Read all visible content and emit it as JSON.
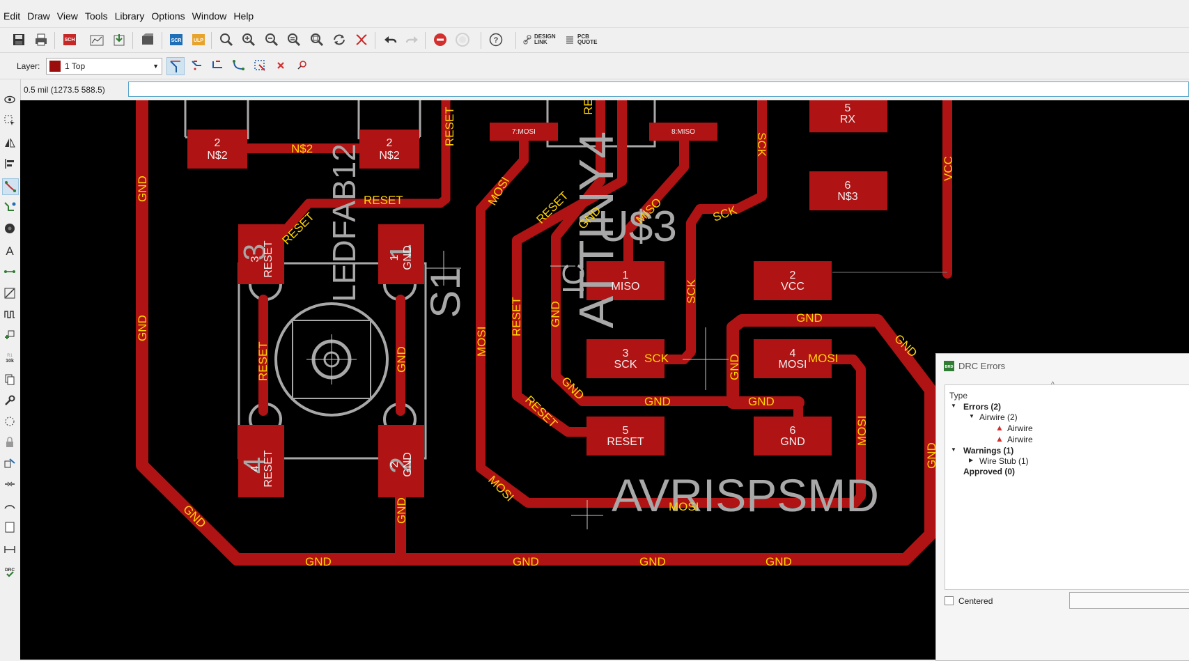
{
  "menu": [
    "Edit",
    "Draw",
    "View",
    "Tools",
    "Library",
    "Options",
    "Window",
    "Help"
  ],
  "toolbar": {
    "design_link": [
      "DESIGN",
      "LINK"
    ],
    "pcb_quote": [
      "PCB",
      "QUOTE"
    ],
    "sch_label": "SCH",
    "scr_label": "SCR",
    "ulp_label": "ULP"
  },
  "layer": {
    "label": "Layer:",
    "value": "1 Top",
    "color": "#9b0c0c"
  },
  "status": {
    "coords": "0.5 mil (1273.5 588.5)",
    "command": ""
  },
  "board": {
    "pads": [
      {
        "num": "2",
        "name": "N$2"
      },
      {
        "num": "2",
        "name": "N$2"
      },
      {
        "num": "3",
        "name": "RESET"
      },
      {
        "num": "1",
        "name": "GND"
      },
      {
        "num": "4",
        "name": "RESET"
      },
      {
        "num": "2",
        "name": "GND"
      },
      {
        "num": "1",
        "name": "MISO"
      },
      {
        "num": "3",
        "name": "SCK"
      },
      {
        "num": "5",
        "name": "RESET"
      },
      {
        "num": "2",
        "name": "VCC"
      },
      {
        "num": "4",
        "name": "MOSI"
      },
      {
        "num": "6",
        "name": "GND"
      },
      {
        "num": "5",
        "name": "RX"
      },
      {
        "num": "6",
        "name": "N$3"
      }
    ],
    "via_labels": [
      "7:MOSI",
      "8:MISO"
    ],
    "trace_labels": {
      "n2": "N$2",
      "reset": "RESET",
      "gnd": "GND",
      "mosi": "MOSI",
      "miso": "MISO",
      "sck": "SCK",
      "vcc": "VCC",
      "re": "RE"
    },
    "silk": {
      "fab": "LEDFAB12",
      "s1": "S1",
      "u3": "U$3",
      "tiny": "ATTINY4",
      "avr": "AVRISPSMD",
      "ic": "IC"
    }
  },
  "drc": {
    "title": "DRC Errors",
    "col_type": "Type",
    "errors": "Errors (2)",
    "airwire_group": "Airwire (2)",
    "airwire_items": [
      "Airwire",
      "Airwire"
    ],
    "warnings": "Warnings (1)",
    "wire_stub": "Wire Stub (1)",
    "approved": "Approved (0)",
    "centered": "Centered",
    "icon_label": "BRD"
  }
}
